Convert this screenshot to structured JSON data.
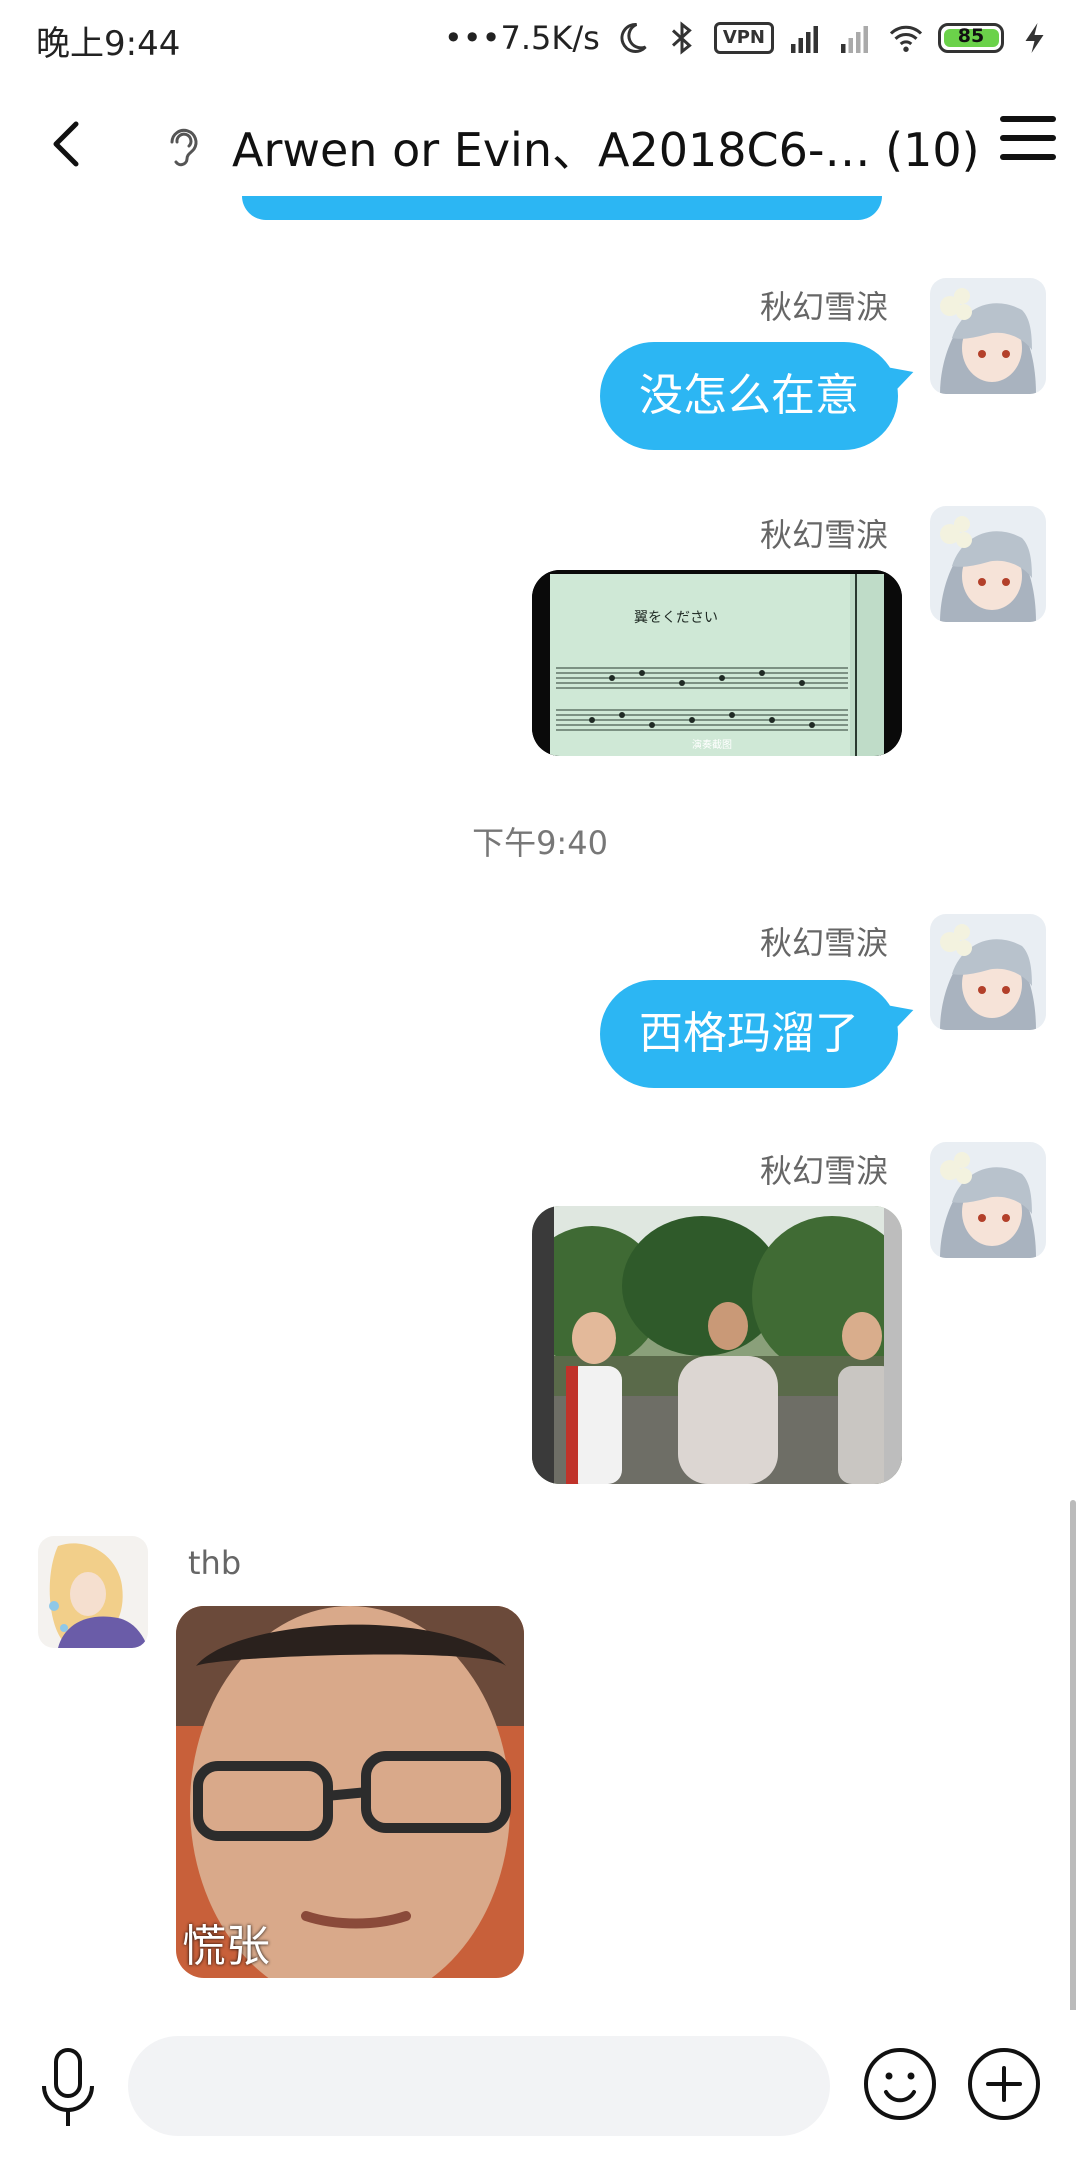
{
  "status_bar": {
    "time": "晚上9:44",
    "net_speed": "•••7.5K/s",
    "vpn": "VPN",
    "battery": "85"
  },
  "header": {
    "title": "Arwen or Evin、A2018C6-… (10)"
  },
  "messages": {
    "m1": {
      "sender": "秋幻雪淚",
      "text": "没怎么在意"
    },
    "m2": {
      "sender": "秋幻雪淚",
      "image_caption": "翼をください",
      "image_subtitle": "演奏截图"
    },
    "timestamp": "下午9:40",
    "m3": {
      "sender": "秋幻雪淚",
      "text": "西格玛溜了"
    },
    "m4": {
      "sender": "秋幻雪淚"
    },
    "m5": {
      "sender": "thb",
      "sticker_text": "慌张"
    }
  },
  "colors": {
    "bubble": "#2cb6f3",
    "battery": "#6bd24a"
  },
  "icons": [
    "back-icon",
    "ear-icon",
    "menu-icon",
    "mic-icon",
    "emoji-icon",
    "plus-icon"
  ]
}
